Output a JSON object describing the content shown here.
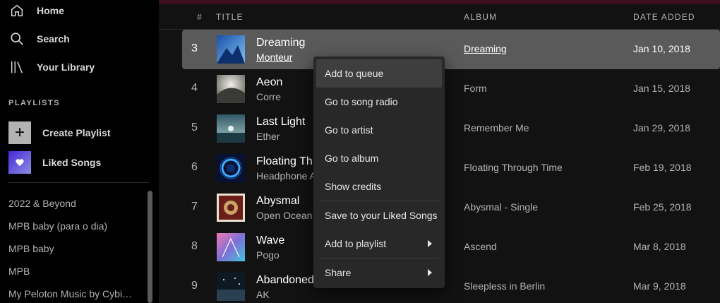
{
  "sidebar": {
    "nav": [
      {
        "label": "Home",
        "icon": "home-icon"
      },
      {
        "label": "Search",
        "icon": "search-icon"
      },
      {
        "label": "Your Library",
        "icon": "library-icon"
      }
    ],
    "playlists_title": "PLAYLISTS",
    "create_playlist": "Create Playlist",
    "liked_songs": "Liked Songs",
    "playlists": [
      "2022 & Beyond",
      "MPB baby (para o dia)",
      "MPB baby",
      "MPB",
      "My Peloton Music by Cybi…"
    ]
  },
  "table": {
    "headers": {
      "num": "#",
      "title": "TITLE",
      "album": "ALBUM",
      "date": "DATE ADDED"
    },
    "rows": [
      {
        "num": "3",
        "title": "Dreaming",
        "artist": "Monteur",
        "album": "Dreaming",
        "date": "Jan 10, 2018"
      },
      {
        "num": "4",
        "title": "Aeon",
        "artist": "Corre",
        "album": "Form",
        "date": "Jan 15, 2018"
      },
      {
        "num": "5",
        "title": "Last Light",
        "artist": "Ether",
        "album": "Remember Me",
        "date": "Jan 29, 2018"
      },
      {
        "num": "6",
        "title": "Floating Th",
        "artist": "Headphone A",
        "album": "Floating Through Time",
        "date": "Feb 19, 2018"
      },
      {
        "num": "7",
        "title": "Abysmal",
        "artist": "Open Ocean",
        "album": "Abysmal - Single",
        "date": "Feb 25, 2018"
      },
      {
        "num": "8",
        "title": "Wave",
        "artist": "Pogo",
        "album": "Ascend",
        "date": "Mar 8, 2018"
      },
      {
        "num": "9",
        "title": "Abandoned",
        "artist": "AK",
        "album": "Sleepless in Berlin",
        "date": "Mar 9, 2018"
      }
    ]
  },
  "context_menu": {
    "items": [
      {
        "label": "Add to queue"
      },
      {
        "label": "Go to song radio"
      },
      {
        "label": "Go to artist"
      },
      {
        "label": "Go to album"
      },
      {
        "label": "Show credits"
      },
      {
        "label": "Save to your Liked Songs"
      },
      {
        "label": "Add to playlist"
      },
      {
        "label": "Share"
      }
    ]
  },
  "colors": {
    "background": "#121212",
    "sidebar": "#000000",
    "active_row": "#5a5a5a",
    "menu": "#282828",
    "top_strip": "#3b0f1e"
  }
}
